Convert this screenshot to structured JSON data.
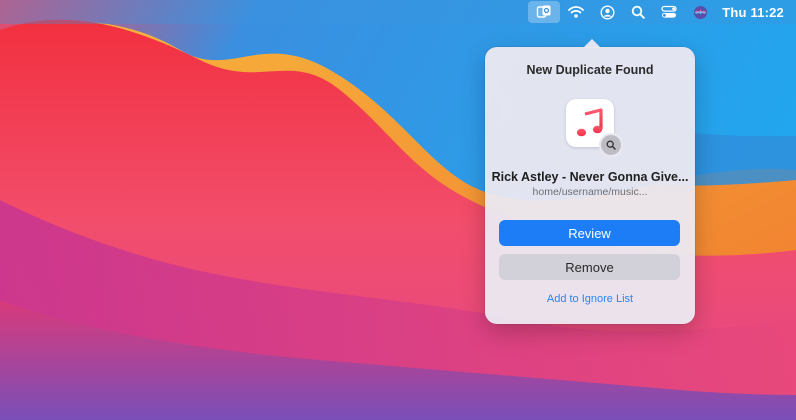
{
  "menubar": {
    "clock": "Thu 11:22",
    "icons": [
      "duplicate-finder-icon",
      "wifi-icon",
      "user-icon",
      "search-icon",
      "control-center-icon",
      "siri-icon"
    ]
  },
  "popover": {
    "title": "New Duplicate Found",
    "app_icon": "music-note-icon",
    "badge_icon": "search-icon",
    "file_name": "Rick Astley - Never Gonna Give...",
    "file_path": "home/username/music...",
    "review_label": "Review",
    "remove_label": "Remove",
    "ignore_label": "Add to Ignore List"
  },
  "colors": {
    "accent": "#1c7df7",
    "link": "#2a86f0",
    "popover_bg": "#eae8f0"
  }
}
